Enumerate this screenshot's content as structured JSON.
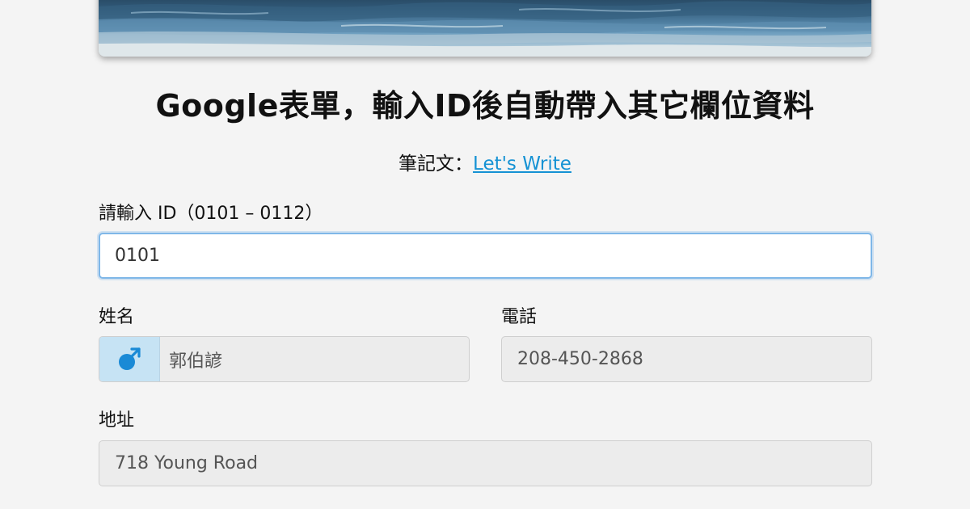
{
  "header": {
    "title": "Google表單，輸入ID後自動帶入其它欄位資料",
    "subtitle_prefix": "筆記文：",
    "subtitle_link": "Let's Write"
  },
  "form": {
    "id_label": "請輸入 ID（0101 – 0112）",
    "id_value": "0101",
    "name_label": "姓名",
    "name_value": "郭伯諺",
    "gender_icon": "male-icon",
    "phone_label": "電話",
    "phone_value": "208-450-2868",
    "address_label": "地址",
    "address_value": "718 Young Road"
  },
  "colors": {
    "link": "#1592d4",
    "icon": "#1a8ad6",
    "addon_bg": "#c6e3f4",
    "focus_border": "#7fb7e8"
  }
}
